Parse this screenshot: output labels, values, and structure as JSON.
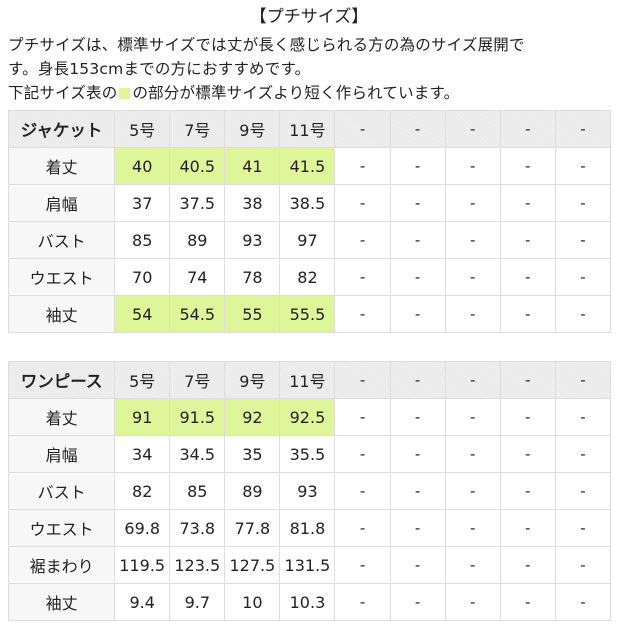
{
  "title": "【プチサイズ】",
  "intro": {
    "line1": "プチサイズは、標準サイズでは丈が長く感じられる方の為のサイズ展開で",
    "line2": "す。身長153cmまでの方におすすめです。",
    "line3_before": "下記サイズ表の",
    "line3_after": "の部分が標準サイズより短く作られています。",
    "legend_color": "#dff59a"
  },
  "highlight_color": "#dff59a",
  "tables": [
    {
      "name": "ジャケット",
      "columns": [
        "5号",
        "7号",
        "9号",
        "11号",
        "-",
        "-",
        "-",
        "-",
        "-"
      ],
      "rows": [
        {
          "label": "着丈",
          "highlight": true,
          "values": [
            "40",
            "40.5",
            "41",
            "41.5",
            "-",
            "-",
            "-",
            "-",
            "-"
          ]
        },
        {
          "label": "肩幅",
          "highlight": false,
          "values": [
            "37",
            "37.5",
            "38",
            "38.5",
            "-",
            "-",
            "-",
            "-",
            "-"
          ]
        },
        {
          "label": "バスト",
          "highlight": false,
          "values": [
            "85",
            "89",
            "93",
            "97",
            "-",
            "-",
            "-",
            "-",
            "-"
          ]
        },
        {
          "label": "ウエスト",
          "highlight": false,
          "values": [
            "70",
            "74",
            "78",
            "82",
            "-",
            "-",
            "-",
            "-",
            "-"
          ]
        },
        {
          "label": "袖丈",
          "highlight": true,
          "values": [
            "54",
            "54.5",
            "55",
            "55.5",
            "-",
            "-",
            "-",
            "-",
            "-"
          ]
        }
      ]
    },
    {
      "name": "ワンピース",
      "columns": [
        "5号",
        "7号",
        "9号",
        "11号",
        "-",
        "-",
        "-",
        "-",
        "-"
      ],
      "rows": [
        {
          "label": "着丈",
          "highlight": true,
          "values": [
            "91",
            "91.5",
            "92",
            "92.5",
            "-",
            "-",
            "-",
            "-",
            "-"
          ]
        },
        {
          "label": "肩幅",
          "highlight": false,
          "values": [
            "34",
            "34.5",
            "35",
            "35.5",
            "-",
            "-",
            "-",
            "-",
            "-"
          ]
        },
        {
          "label": "バスト",
          "highlight": false,
          "values": [
            "82",
            "85",
            "89",
            "93",
            "-",
            "-",
            "-",
            "-",
            "-"
          ]
        },
        {
          "label": "ウエスト",
          "highlight": false,
          "values": [
            "69.8",
            "73.8",
            "77.8",
            "81.8",
            "-",
            "-",
            "-",
            "-",
            "-"
          ]
        },
        {
          "label": "裾まわり",
          "highlight": false,
          "values": [
            "119.5",
            "123.5",
            "127.5",
            "131.5",
            "-",
            "-",
            "-",
            "-",
            "-"
          ]
        },
        {
          "label": "袖丈",
          "highlight": false,
          "values": [
            "9.4",
            "9.7",
            "10",
            "10.3",
            "-",
            "-",
            "-",
            "-",
            "-"
          ]
        }
      ]
    }
  ]
}
